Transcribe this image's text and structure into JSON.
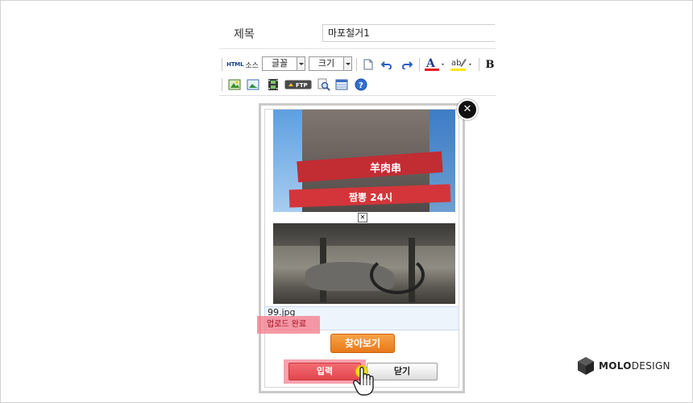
{
  "form": {
    "title_label": "제목",
    "title_value": "마포철거1"
  },
  "toolbar": {
    "source_tag": "HTML",
    "source_label": "소스",
    "font_label": "글꼴",
    "size_label": "크기",
    "bold_label": "B",
    "ftp_label": "FTP"
  },
  "popup": {
    "file_name": "99.jpg",
    "upload_status": "업로드 완료",
    "image1_sign": "羊肉串",
    "image1_sign2": "짬뽕 24시",
    "browse_label": "찾아보기",
    "submit_label": "입력",
    "close_label": "닫기"
  },
  "brand": {
    "logo_bold": "MOLO",
    "logo_light": "DESIGN"
  },
  "colors": {
    "browse": "#ee8a2e",
    "submit": "#e8505a",
    "highlight": "#f58291",
    "font_color_bar": "#e51c1c",
    "bg_color_bar": "#ffe600"
  }
}
